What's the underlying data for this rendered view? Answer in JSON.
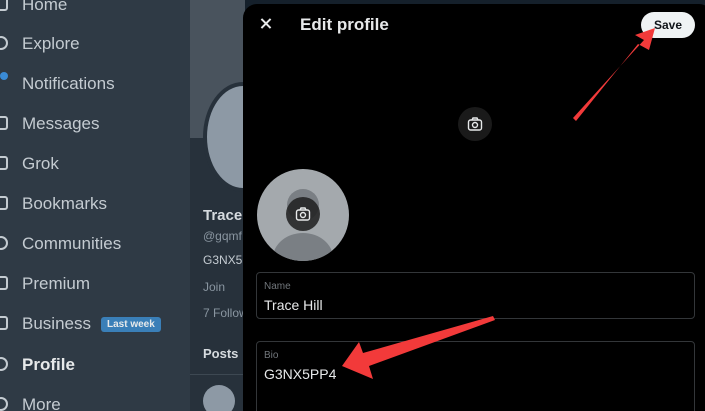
{
  "sidebar": {
    "items": [
      {
        "label": "Home",
        "icon": "home-icon"
      },
      {
        "label": "Explore",
        "icon": "search-icon"
      },
      {
        "label": "Notifications",
        "icon": "bell-icon"
      },
      {
        "label": "Messages",
        "icon": "mail-icon"
      },
      {
        "label": "Grok",
        "icon": "grok-icon"
      },
      {
        "label": "Bookmarks",
        "icon": "bookmark-icon"
      },
      {
        "label": "Communities",
        "icon": "people-icon"
      },
      {
        "label": "Premium",
        "icon": "x-icon"
      },
      {
        "label": "Business",
        "icon": "lightning-icon",
        "badge": "Last week"
      },
      {
        "label": "Profile",
        "icon": "person-icon"
      },
      {
        "label": "More",
        "icon": "more-icon"
      }
    ]
  },
  "background_profile": {
    "name": "Trace",
    "handle": "@gqmf",
    "bio": "G3NX5",
    "joined": "Join",
    "follow": "7 Follow",
    "tab": "Posts"
  },
  "modal": {
    "title": "Edit profile",
    "save_label": "Save",
    "name_field": {
      "label": "Name",
      "value": "Trace Hill"
    },
    "bio_field": {
      "label": "Bio",
      "value": "G3NX5PP4"
    }
  },
  "colors": {
    "accent": "#1d9bf0",
    "annotation_arrow": "#f23a3a",
    "modal_bg": "#000000",
    "sidebar_bg": "#2f3a45"
  }
}
